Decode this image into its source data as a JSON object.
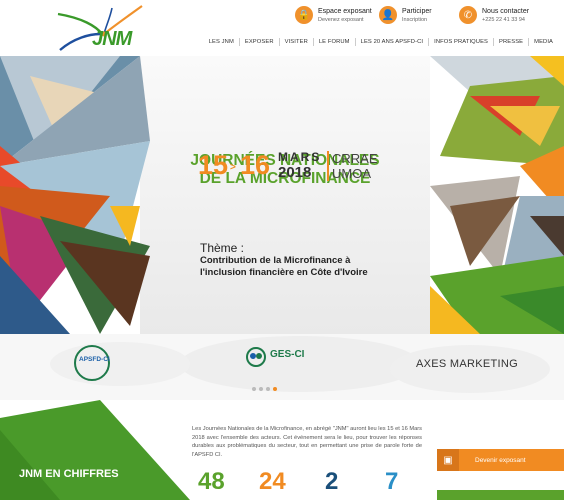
{
  "header": {
    "logo_text": "JNM",
    "contacts": [
      {
        "label": "Espace exposant",
        "sub": "Devenez exposant",
        "icon": "lock-icon"
      },
      {
        "label": "Participer",
        "sub": "Inscription",
        "icon": "user-icon"
      },
      {
        "label": "Nous contacter",
        "sub": "+225 22 41 33 94",
        "icon": "phone-icon"
      }
    ],
    "nav": [
      "LES JNM",
      "EXPOSER",
      "VISITER",
      "LE FORUM",
      "LES 20 ANS APSFD-CI",
      "INFOS PRATIQUES",
      "PRESSE",
      "MEDIA"
    ]
  },
  "hero": {
    "title_line1": "JOURNÉES NATIONALES",
    "title_line2": "DE LA MICROFINANCE",
    "day_start": "15",
    "day_end": "16",
    "arrow": ">",
    "month": "MARS",
    "year": "2018",
    "org_line1": "CRRAE",
    "org_line2": "UMOA",
    "theme_label": "Thème :",
    "theme_line1": "Contribution de la Microfinance à",
    "theme_line2": "l'inclusion financière en Côte d'Ivoire"
  },
  "partners": {
    "apsfd": "APSFD-CI",
    "gesci": "GES-CI",
    "axes": "AXES MARKETING"
  },
  "intro_text": "Les Journées Nationales de la Microfinance, en abrégé \"JNM\" auront lieu les 15 et 16 Mars 2018 avec l'ensemble des acteurs. Cet événement sera le lieu, pour trouver les réponses durables aux problématiques du secteur, tout en permettant une prise de parole forte de l'APSFD CI.",
  "chiffres": {
    "title": "JNM EN CHIFFRES",
    "values": [
      "48",
      "24",
      "2",
      "7"
    ],
    "colors": [
      "#5aa22c",
      "#f18b22",
      "#1a4f7a",
      "#2a8fc7"
    ]
  },
  "sidebar_buttons": {
    "exposant": "Devenir exposant"
  },
  "colors": {
    "orange": "#f18b22",
    "green": "#5aa22c",
    "navy": "#1a4f7a"
  }
}
